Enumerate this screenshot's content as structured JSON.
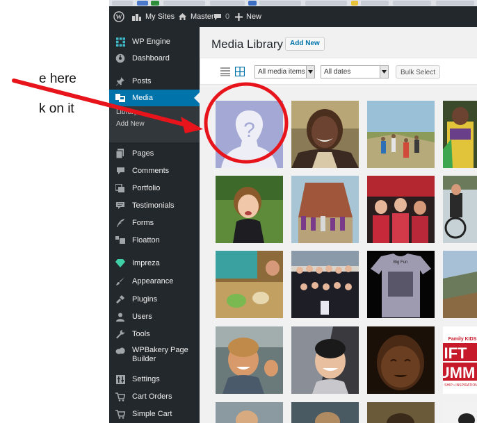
{
  "annotation": {
    "line1": "e here",
    "line2": "k on it",
    "color": "#e8141b"
  },
  "admin_bar": {
    "my_sites": "My Sites",
    "site_name": "Master",
    "comments_count": "0",
    "new_label": "New"
  },
  "sidebar": {
    "items": [
      {
        "label": "WP Engine",
        "icon": "wp-engine-icon"
      },
      {
        "label": "Dashboard",
        "icon": "dashboard-icon"
      },
      {
        "label": "Posts",
        "icon": "pin-icon"
      },
      {
        "label": "Media",
        "icon": "media-icon"
      },
      {
        "label": "Pages",
        "icon": "pages-icon"
      },
      {
        "label": "Comments",
        "icon": "comments-icon"
      },
      {
        "label": "Portfolio",
        "icon": "portfolio-icon"
      },
      {
        "label": "Testimonials",
        "icon": "testimonials-icon"
      },
      {
        "label": "Forms",
        "icon": "forms-icon"
      },
      {
        "label": "Floatton",
        "icon": "floatton-icon"
      },
      {
        "label": "Impreza",
        "icon": "diamond-icon"
      },
      {
        "label": "Appearance",
        "icon": "brush-icon"
      },
      {
        "label": "Plugins",
        "icon": "plug-icon"
      },
      {
        "label": "Users",
        "icon": "user-icon"
      },
      {
        "label": "Tools",
        "icon": "wrench-icon"
      },
      {
        "label": "WPBakery Page Builder",
        "icon": "cloud-icon"
      },
      {
        "label": "Settings",
        "icon": "settings-icon"
      },
      {
        "label": "Cart Orders",
        "icon": "cart-icon"
      },
      {
        "label": "Simple Cart",
        "icon": "cart-icon"
      }
    ],
    "wpbakery_line1": "WPBakery Page",
    "wpbakery_line2": "Builder",
    "media_submenu": {
      "library": "Library",
      "add_new": "Add New"
    }
  },
  "main": {
    "title": "Media Library",
    "add_new": "Add New",
    "filter_type": "All media items",
    "filter_date": "All dates",
    "bulk_select": "Bulk Select"
  },
  "colors": {
    "admin_dark": "#23282d",
    "accent_blue": "#0073aa",
    "placeholder_bg": "#a4a8d4"
  }
}
